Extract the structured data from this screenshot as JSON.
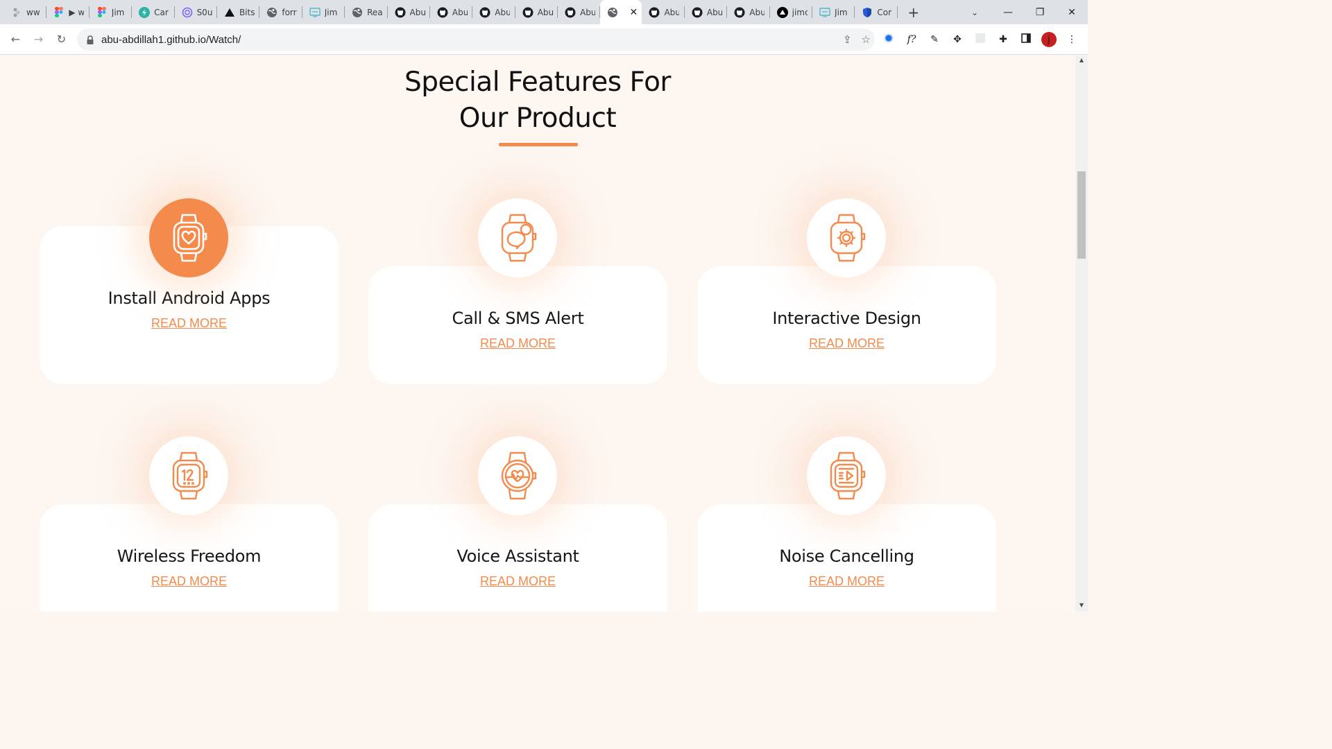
{
  "browser": {
    "tabs": [
      {
        "title": "ww",
        "icon": "figma-grey-icon"
      },
      {
        "title": "▶ w",
        "icon": "figma-icon"
      },
      {
        "title": "Jim",
        "icon": "figma-icon"
      },
      {
        "title": "Car",
        "icon": "bolt-circle-icon"
      },
      {
        "title": "S0u",
        "icon": "swirl-icon"
      },
      {
        "title": "Bits",
        "icon": "triangle-icon"
      },
      {
        "title": "forr",
        "icon": "globe-icon"
      },
      {
        "title": "Jim",
        "icon": "window-icon"
      },
      {
        "title": "Rea",
        "icon": "globe-icon"
      },
      {
        "title": "Abu",
        "icon": "github-icon"
      },
      {
        "title": "Abu",
        "icon": "github-icon"
      },
      {
        "title": "Abu",
        "icon": "github-icon"
      },
      {
        "title": "Abu",
        "icon": "github-icon"
      },
      {
        "title": "Abu",
        "icon": "github-icon"
      },
      {
        "title": "",
        "icon": "globe-icon",
        "active": true
      },
      {
        "title": "Abu",
        "icon": "github-icon"
      },
      {
        "title": "Abu",
        "icon": "github-icon"
      },
      {
        "title": "Abu",
        "icon": "github-icon"
      },
      {
        "title": "jimc",
        "icon": "vercel-icon"
      },
      {
        "title": "Jim",
        "icon": "window-icon"
      },
      {
        "title": "Cor",
        "icon": "shield-icon"
      }
    ],
    "url": "abu-abdillah1.github.io/Watch/",
    "avatar_letter": "j",
    "accent_color": "#f48a4c"
  },
  "section": {
    "heading_line1": "Special Features For",
    "heading_line2": "Our Product"
  },
  "features": [
    {
      "title": "Install Android Apps",
      "link": "READ MORE",
      "icon": "watch-heart-icon",
      "highlighted": true
    },
    {
      "title": "Call & SMS Alert",
      "link": "READ MORE",
      "icon": "watch-chat-icon",
      "highlighted": false
    },
    {
      "title": "Interactive Design",
      "link": "READ MORE",
      "icon": "watch-gear-icon",
      "highlighted": false
    },
    {
      "title": "Wireless Freedom",
      "link": "READ MORE",
      "icon": "watch-clock-icon",
      "highlighted": false
    },
    {
      "title": "Voice Assistant",
      "link": "READ MORE",
      "icon": "watch-pulse-icon",
      "highlighted": false
    },
    {
      "title": "Noise Cancelling",
      "link": "READ MORE",
      "icon": "watch-play-icon",
      "highlighted": false
    }
  ]
}
